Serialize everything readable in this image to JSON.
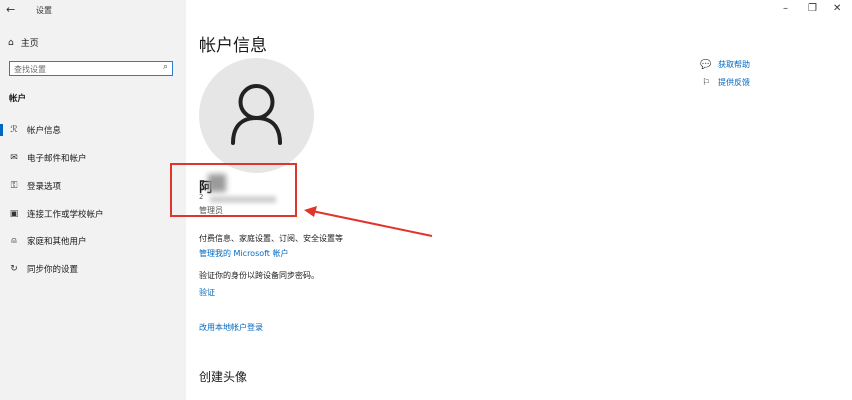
{
  "window": {
    "back_icon": "arrow-left-icon",
    "title": "设置",
    "controls": {
      "minimize": "–",
      "restore": "❐",
      "close": "✕"
    }
  },
  "sidebar": {
    "home_label": "主页",
    "search_placeholder": "查找设置",
    "section_title": "帐户",
    "items": [
      {
        "icon": "person-list-icon",
        "label": "帐户信息",
        "active": true
      },
      {
        "icon": "mail-icon",
        "label": "电子邮件和帐户",
        "active": false
      },
      {
        "icon": "key-icon",
        "label": "登录选项",
        "active": false
      },
      {
        "icon": "briefcase-icon",
        "label": "连接工作或学校帐户",
        "active": false
      },
      {
        "icon": "person-add-icon",
        "label": "家庭和其他用户",
        "active": false
      },
      {
        "icon": "sync-icon",
        "label": "同步你的设置",
        "active": false
      }
    ]
  },
  "main": {
    "title": "帐户信息",
    "user": {
      "name_visible": "阿",
      "line2_visible": "2",
      "role": "管理员"
    },
    "billing_text": "付费信息、家庭设置、订阅、安全设置等",
    "manage_link": "管理我的 Microsoft 帐户",
    "verify_text": "验证你的身份以跨设备同步密码。",
    "verify_link": "验证",
    "local_login_link": "改用本地帐户登录",
    "create_avatar_title": "创建头像"
  },
  "help": {
    "get_help": "获取帮助",
    "feedback": "提供反馈"
  },
  "colors": {
    "accent": "#0067c0",
    "highlight": "#e0352b",
    "sidebar_bg": "#f2f2f2"
  }
}
